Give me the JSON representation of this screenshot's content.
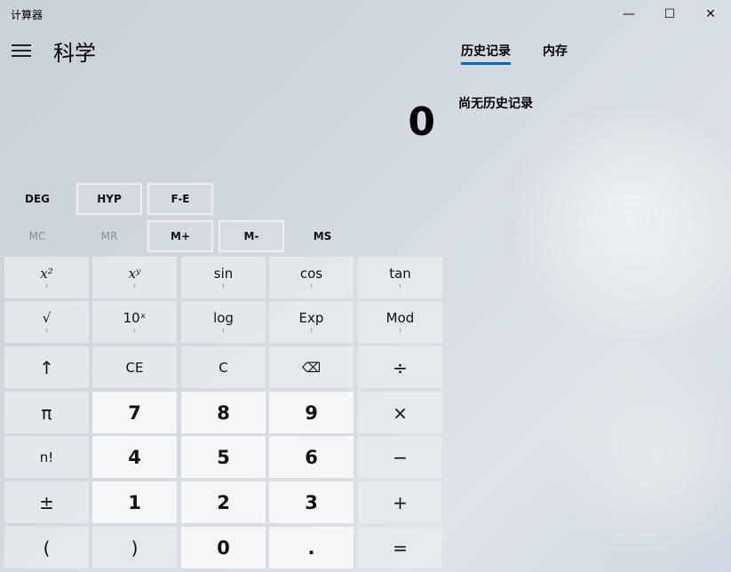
{
  "window": {
    "title": "计算器",
    "minimize": "—",
    "maximize": "☐",
    "close": "✕"
  },
  "header": {
    "mode": "科学"
  },
  "display": {
    "value": "0"
  },
  "tabs": [
    {
      "label": "历史记录",
      "active": true
    },
    {
      "label": "内存",
      "active": false
    }
  ],
  "history": {
    "empty_text": "尚无历史记录"
  },
  "angle_row": {
    "deg": "DEG",
    "hyp": "HYP",
    "fe": "F-E"
  },
  "memory_row": {
    "mc": "MC",
    "mr": "MR",
    "mplus": "M+",
    "mminus": "M-",
    "ms": "MS"
  },
  "keys": {
    "square": "x²",
    "power": "xʸ",
    "sin": "sin",
    "cos": "cos",
    "tan": "tan",
    "sqrt": "√",
    "ten_pow": "10ˣ",
    "log": "log",
    "exp": "Exp",
    "mod": "Mod",
    "shift": "↑",
    "ce": "CE",
    "clear": "C",
    "backspace": "⌫",
    "divide": "÷",
    "pi": "π",
    "seven": "7",
    "eight": "8",
    "nine": "9",
    "multiply": "×",
    "factorial": "n!",
    "four": "4",
    "five": "5",
    "six": "6",
    "minus": "−",
    "negate": "±",
    "one": "1",
    "two": "2",
    "three": "3",
    "plus": "+",
    "lparen": "(",
    "rparen": ")",
    "zero": "0",
    "decimal": ".",
    "equals": "=",
    "shift_hint": "↑"
  }
}
